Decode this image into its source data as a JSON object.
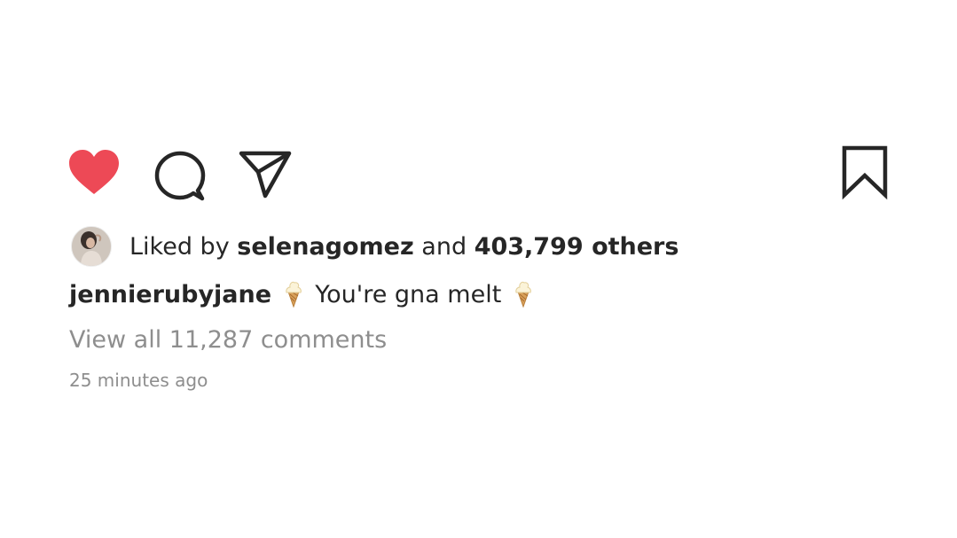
{
  "post": {
    "actions": {
      "like_icon": "heart-filled-icon",
      "comment_icon": "comment-bubble-icon",
      "share_icon": "paper-plane-icon",
      "save_icon": "bookmark-outline-icon",
      "like_color": "#ed4956",
      "icon_color": "#262626"
    },
    "likes": {
      "prefix": "Liked by",
      "user": "selenagomez",
      "conjunction": "and",
      "others": "403,799 others"
    },
    "caption": {
      "username": "jennierubyjane",
      "emoji": "ice-cream-cone-emoji",
      "text": "You're gna melt"
    },
    "comments": {
      "view_all": "View all 11,287 comments"
    },
    "timestamp": "25 minutes ago"
  }
}
